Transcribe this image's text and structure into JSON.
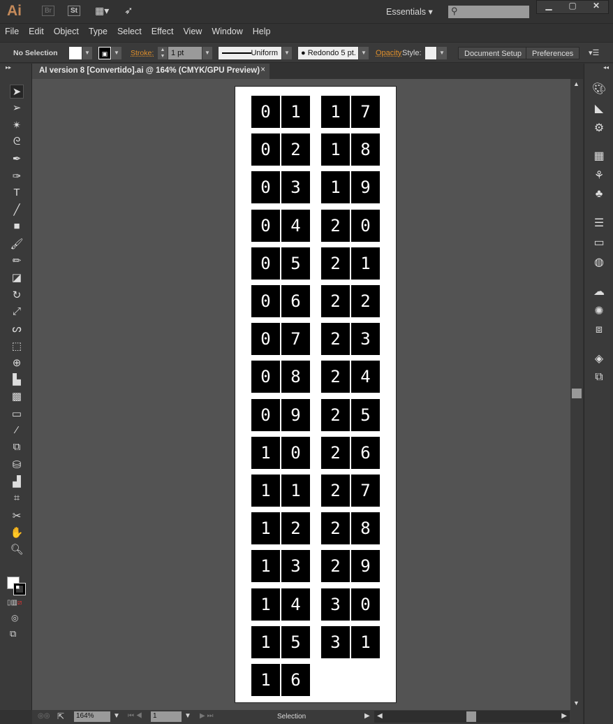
{
  "app": {
    "logo": "Ai",
    "bridge": "Br",
    "stock": "St",
    "workspace": "Essentials",
    "search_placeholder": ""
  },
  "menu": [
    "File",
    "Edit",
    "Object",
    "Type",
    "Select",
    "Effect",
    "View",
    "Window",
    "Help"
  ],
  "control": {
    "selection": "No Selection",
    "stroke_label": "Stroke:",
    "stroke_value": "1 pt",
    "profile": "Uniform",
    "brush": "Redondo 5 pt.",
    "opacity_label": "Opacity",
    "style_label": "Style:",
    "document_setup": "Document Setup",
    "preferences": "Preferences"
  },
  "document": {
    "tab_title": "AI version 8 [Convertido].ai @ 164% (CMYK/GPU Preview)",
    "close": "×"
  },
  "artboard": {
    "left_column": [
      "01",
      "02",
      "03",
      "04",
      "05",
      "06",
      "07",
      "08",
      "09",
      "10",
      "11",
      "12",
      "13",
      "14",
      "15",
      "16"
    ],
    "right_column": [
      "17",
      "18",
      "19",
      "20",
      "21",
      "22",
      "23",
      "24",
      "25",
      "26",
      "27",
      "28",
      "29",
      "30",
      "31"
    ]
  },
  "status": {
    "zoom": "164%",
    "artboard_number": "1",
    "tool": "Selection"
  },
  "tools": [
    "selection",
    "direct-selection",
    "magic-wand",
    "lasso",
    "pen",
    "curvature",
    "type",
    "line",
    "rectangle",
    "paintbrush",
    "pencil",
    "eraser",
    "rotate",
    "scale",
    "warp",
    "free-transform",
    "shape-builder",
    "perspective-grid",
    "mesh",
    "gradient",
    "eyedropper",
    "blend",
    "symbol-sprayer",
    "column-graph",
    "artboard",
    "slice",
    "hand",
    "zoom"
  ],
  "colors": {
    "accent": "#c58a5a",
    "stroke_label": "#e0902c"
  }
}
